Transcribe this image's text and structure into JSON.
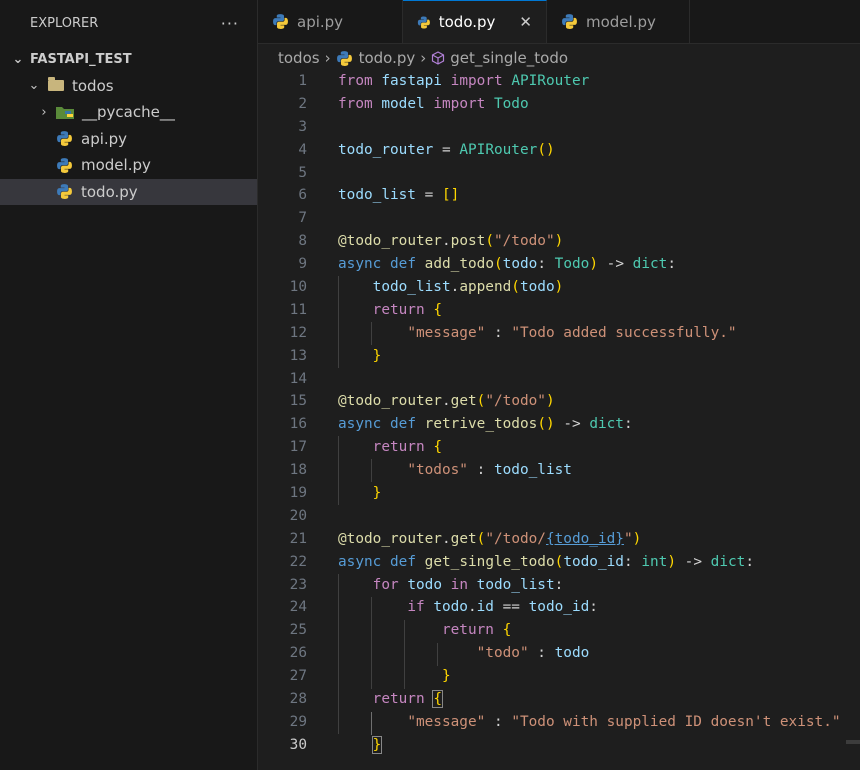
{
  "explorer": {
    "title": "EXPLORER",
    "more_icon": "ellipsis-icon",
    "project": "FASTAPI_TEST",
    "folder": "todos",
    "subfolder": "__pycache__",
    "files": [
      "api.py",
      "model.py",
      "todo.py"
    ],
    "selected_file": "todo.py"
  },
  "tabs": [
    {
      "label": "api.py",
      "active": false
    },
    {
      "label": "todo.py",
      "active": true
    },
    {
      "label": "model.py",
      "active": false
    }
  ],
  "breadcrumb": {
    "folder": "todos",
    "file": "todo.py",
    "symbol": "get_single_todo"
  },
  "editor": {
    "line_numbers": [
      "1",
      "2",
      "3",
      "4",
      "5",
      "6",
      "7",
      "8",
      "9",
      "10",
      "11",
      "12",
      "13",
      "14",
      "15",
      "16",
      "17",
      "18",
      "19",
      "20",
      "21",
      "22",
      "23",
      "24",
      "25",
      "26",
      "27",
      "28",
      "29",
      "30"
    ],
    "current_line": "30",
    "code": {
      "l1": [
        "from",
        "fastapi",
        "import",
        "APIRouter"
      ],
      "l2": [
        "from",
        "model",
        "import",
        "Todo"
      ],
      "l4": [
        "todo_router",
        "=",
        "APIRouter",
        "()"
      ],
      "l6": [
        "todo_list",
        "=",
        "[]"
      ],
      "l8": [
        "@",
        "todo_router",
        ".",
        "post",
        "(",
        "\"/todo\"",
        ")"
      ],
      "l9": [
        "async",
        "def",
        "add_todo",
        "(",
        "todo",
        ":",
        "Todo",
        ")",
        "->",
        "dict",
        ":"
      ],
      "l10": [
        "todo_list",
        ".",
        "append",
        "(",
        "todo",
        ")"
      ],
      "l11": [
        "return",
        "{"
      ],
      "l12": [
        "\"message\"",
        ":",
        "\"Todo added successfully.\""
      ],
      "l13": [
        "}"
      ],
      "l15": [
        "@",
        "todo_router",
        ".",
        "get",
        "(",
        "\"/todo\"",
        ")"
      ],
      "l16": [
        "async",
        "def",
        "retrive_todos",
        "()",
        "->",
        "dict",
        ":"
      ],
      "l17": [
        "return",
        "{"
      ],
      "l18": [
        "\"todos\"",
        ":",
        "todo_list"
      ],
      "l19": [
        "}"
      ],
      "l21": [
        "@",
        "todo_router",
        ".",
        "get",
        "(",
        "\"/todo/",
        "{todo_id}",
        "\"",
        ")"
      ],
      "l22": [
        "async",
        "def",
        "get_single_todo",
        "(",
        "todo_id",
        ":",
        "int",
        ")",
        "->",
        "dict",
        ":"
      ],
      "l23": [
        "for",
        "todo",
        "in",
        "todo_list",
        ":"
      ],
      "l24": [
        "if",
        "todo",
        ".",
        "id",
        "==",
        "todo_id",
        ":"
      ],
      "l25": [
        "return",
        "{"
      ],
      "l26": [
        "\"todo\"",
        ":",
        "todo"
      ],
      "l27": [
        "}"
      ],
      "l28": [
        "return",
        "{"
      ],
      "l29": [
        "\"message\"",
        ":",
        "\"Todo with supplied ID doesn't exist.\""
      ],
      "l30": [
        "}"
      ]
    }
  },
  "colors": {
    "keyword": "#c586c0",
    "storage": "#569cd6",
    "function": "#dcdcaa",
    "variable": "#9cdcfe",
    "class": "#4ec9b0",
    "string": "#ce9178",
    "bracket_level1": "#ffd700",
    "bracket_level2": "#da70d6",
    "accent": "#0078d4"
  }
}
